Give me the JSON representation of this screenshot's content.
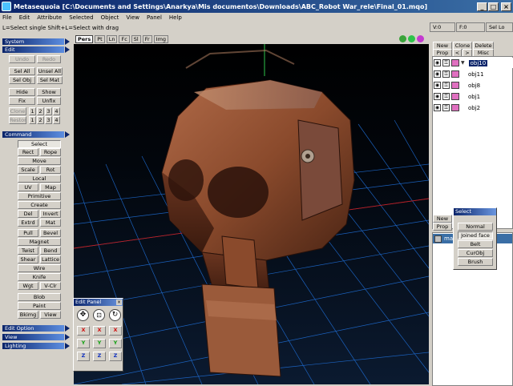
{
  "titlebar": {
    "title": "Metasequoia [C:\\Documents and Settings\\Anarkya\\Mis documentos\\Downloads\\ABC_Robot War_rele\\Final_01.mqo]",
    "minimize": "_",
    "maximize": "□",
    "close": "×"
  },
  "menu": [
    "File",
    "Edit",
    "Attribute",
    "Selected",
    "Object",
    "View",
    "Panel",
    "Help"
  ],
  "status_hint": "L=Select single  Shift+L=Select with drag",
  "left_panel": {
    "sections": {
      "system": "System",
      "edit": "Edit",
      "command": "Command",
      "edit_option": "Edit Option",
      "view": "View",
      "lighting": "Lighting"
    },
    "edit_buttons": {
      "undo": "Undo",
      "redo": "Redo",
      "sel_all": "Sel All",
      "unsel_all": "Unsel All",
      "sel_obj": "Sel Obj",
      "sel_mat": "Sel Mat",
      "hide": "Hide",
      "show": "Show",
      "fix": "Fix",
      "unfix": "Unfix",
      "clone": "Clone",
      "restore": "Restore",
      "n1": "1",
      "n2": "2",
      "n3": "3",
      "n4": "4"
    },
    "command_buttons": {
      "select": "Select",
      "rect": "Rect",
      "rope": "Rope",
      "move": "Move",
      "scale": "Scale",
      "rot": "Rot",
      "local": "Local",
      "uv": "UV",
      "map": "Map",
      "primitive": "Primitive",
      "create": "Create",
      "del": "Del",
      "invert": "Invert",
      "extrd": "Extrd",
      "mat": "Mat",
      "pull": "Pull",
      "bevel": "Bevel",
      "magnet": "Magnet",
      "twist": "Twist",
      "bend": "Bend",
      "shear": "Shear",
      "lattice": "Lattice",
      "wire": "Wire",
      "knife": "Knife",
      "wgt": "Wgt",
      "v_clr": "V-Clr",
      "blob": "Blob",
      "paint": "Paint",
      "bkimg": "Bkimg",
      "view": "View"
    }
  },
  "viewport": {
    "mode_buttons": [
      "Pers",
      "Pt",
      "Ln",
      "Fc",
      "Sl",
      "Fr",
      "Img"
    ],
    "active_mode": "Pers"
  },
  "right_panel": {
    "tabs_top": [
      "V:0",
      "F:0",
      "Sel Lo"
    ],
    "object_buttons": {
      "new": "New",
      "clone": "Clone",
      "delete": "Delete",
      "prop": "Prop",
      "prev": "<",
      "next": ">",
      "misc": "Misc"
    },
    "objects": [
      "obj10",
      "obj11",
      "obj8",
      "obj1",
      "obj2"
    ],
    "active_object": "obj10",
    "material_buttons": {
      "new": "New",
      "prop": "Prop"
    },
    "material_item": "ma",
    "swatch_color": "#e070c0"
  },
  "select_panel": {
    "title": "Select",
    "items": [
      "Normal",
      "Joined face",
      "Belt",
      "CurObj",
      "Brush"
    ]
  },
  "edit_panel": {
    "title": "Edit Panel",
    "axis_x": "X",
    "axis_y": "Y",
    "axis_z": "Z"
  },
  "colors": {
    "title_bar": "#0a246a",
    "viewport_bg": "#000000",
    "grid": "#1f6fd8",
    "mesh_rust": "#8a4a2c"
  }
}
